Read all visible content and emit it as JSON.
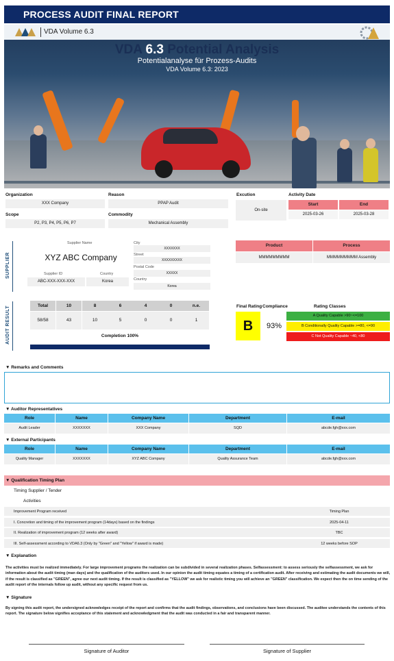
{
  "header": {
    "title": "PROCESS AUDIT FINAL REPORT"
  },
  "banner": {
    "vda_volume": "VDA Volume 6.3",
    "title_left": "VDA ",
    "title_num": "6.3",
    "title_right": " Potential Analysis",
    "subtitle": "Potentialanalyse für Prozess-Audits",
    "subtitle2": "VDA Volume 6.3: 2023"
  },
  "info": {
    "organization_label": "Organization",
    "organization": "XXX Company",
    "reason_label": "Reason",
    "reason": "PPAP Audit",
    "scope_label": "Scope",
    "scope": "P2, P3, P4, P5, P6, P7",
    "commodity_label": "Commodity",
    "commodity": "Mechanical Assembly",
    "execution_label": "Excution",
    "execution": "On-site",
    "activity_label": "Activity Date",
    "start_label": "Start",
    "start": "2025-03-26",
    "end_label": "End",
    "end": "2025-03-28"
  },
  "supplier": {
    "side_label": "SUPPLIER",
    "name_label": "Supplier Name",
    "name": "XYZ ABC Company",
    "id_label": "Supplier ID",
    "id": "ABC-XXX-XXX-XXX",
    "country_label": "Country",
    "country": "Korea",
    "city_label": "City",
    "city": "XXXXXXX",
    "street_label": "Street",
    "street": "XXXXXXXXX",
    "postal_label": "Postal Code",
    "postal": "XXXXX",
    "country2_label": "Country",
    "country2": "Korea",
    "product_label": "Product",
    "product": "MMMMMMMMM",
    "process_label": "Process",
    "process": "MMMMMMMMM Assembly"
  },
  "audit": {
    "side_label": "AUDIT RESULT",
    "headers": [
      "Total",
      "10",
      "8",
      "6",
      "4",
      "0",
      "n.e."
    ],
    "values": [
      "58/58",
      "43",
      "10",
      "5",
      "0",
      "0",
      "1"
    ],
    "completion": "Completion 100%",
    "completion_fraction": 1.0,
    "final_rating_label": "Final Rating",
    "final_rating": "B",
    "compliance_label": "Compliance",
    "compliance": "93%",
    "classes_label": "Rating Classes",
    "class_a": "A Quality Capable  >90~<=100",
    "class_b": "B Conditionally Quality Capable  >=80, <=90",
    "class_c": "C Not Quality Capable  ~40, <80",
    "colors": {
      "a": "#3cb043",
      "b": "#ffee00",
      "c": "#ee1c1c",
      "rating_bg": "#ffff00",
      "bar": "#0e2a67"
    }
  },
  "remarks": {
    "title": "▼ Remarks and Comments"
  },
  "auditors": {
    "title": "▼ Auditor Representatives",
    "columns": [
      "Role",
      "Name",
      "Company Name",
      "Department",
      "E-mail"
    ],
    "row": [
      "Audit Leader",
      "XXXXXXX",
      "XXX Company",
      "SQD",
      "abcde.fgh@xxx.com"
    ]
  },
  "external": {
    "title": "▼ External Participants",
    "columns": [
      "Role",
      "Name",
      "Company Name",
      "Department",
      "E-mail"
    ],
    "row": [
      "Quality Manager",
      "XXXXXXX",
      "XYZ ABC Company",
      "Quality Assurance Team",
      "abcde.fgh@xxx.com"
    ]
  },
  "timing": {
    "title": "▼ Qualification Timing Plan",
    "sub1": "Timing Supplier / Tender",
    "sub2": "Activities",
    "rows": [
      {
        "activity": "Improvement Program received",
        "value": "Timing Plan"
      },
      {
        "activity": "I. Concretion and timing of the improvement program (14days) based on the findings",
        "value": "2025-04-11"
      },
      {
        "activity": "II. Realization of improvement program (12 weeks after award)",
        "value": "TBC"
      },
      {
        "activity": "III. Self-assessment according to VDA6.3 (Only by \"Green\" and \"Yellow\" if award is made)",
        "value": "12 weeks before SOP"
      }
    ]
  },
  "explanation": {
    "title": "▼ Explanation",
    "text": "The activities must be realized immediately.  For large improvement programs the realization can be subdivided in several realization phases. Selfassessment: to assess seriously the selfassessment, we ask for information about the audit timing (man days) and the qualification of the auditors used. In our opinion the audit timing equates a timing of a certification audit. After receiving and estimating the audit documents  we will, if the result is classified as \"GREEN\", agree our next audit timing. If the result is classified as \"YELLOW\" we ask for realistic timing you will achieve an \"GREEN\" classification. We expect then the on time sending of the audit report of the internals follow up audit, without  any specific request from us."
  },
  "signature": {
    "title": "▼ Signature",
    "text": "By signing this audit report, the undersigned acknowledges receipt of the report and confirms that the audit findings, observations, and conclusions have been discussed. The auditee understands the contents of this report. The signature below signifies acceptance of this statement and acknowledgment that the audit was conducted in a fair and transparent manner.",
    "auditor": "Signature of Auditor",
    "supplier": "Signature of Supplier"
  }
}
